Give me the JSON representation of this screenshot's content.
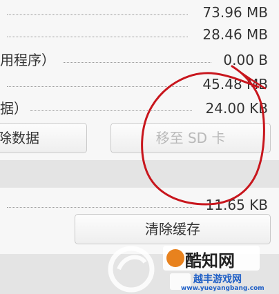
{
  "storage_rows": [
    {
      "label": "",
      "value": "73.96 MB"
    },
    {
      "label": "",
      "value": "28.46 MB"
    },
    {
      "label": "用程序）",
      "value": "0.00 B"
    },
    {
      "label": "",
      "value": "45.48 MB"
    },
    {
      "label": "据）",
      "value": "24.00 KB"
    }
  ],
  "buttons": {
    "clear_data": "除数据",
    "move_to_sd": "移至 SD 卡",
    "clear_cache": "清除缓存"
  },
  "cache": {
    "value": "11.65 KB"
  },
  "watermark": {
    "brand": "酷知网",
    "site_name": "越丰游戏网",
    "site_url": "www.yueyangbang.com"
  },
  "colors": {
    "annotation_red": "#c8161d",
    "disabled_text": "#b9b9b9",
    "watermark_orange": "#e8821e",
    "watermark_blue": "#1f5fc6"
  }
}
